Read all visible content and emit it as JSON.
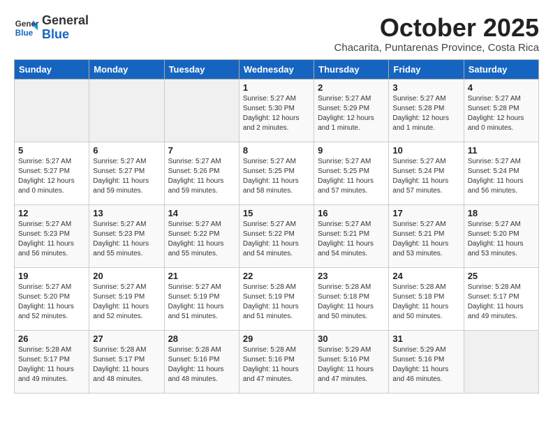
{
  "header": {
    "logo_general": "General",
    "logo_blue": "Blue",
    "month_title": "October 2025",
    "subtitle": "Chacarita, Puntarenas Province, Costa Rica"
  },
  "days_of_week": [
    "Sunday",
    "Monday",
    "Tuesday",
    "Wednesday",
    "Thursday",
    "Friday",
    "Saturday"
  ],
  "weeks": [
    [
      {
        "day": "",
        "details": ""
      },
      {
        "day": "",
        "details": ""
      },
      {
        "day": "",
        "details": ""
      },
      {
        "day": "1",
        "details": "Sunrise: 5:27 AM\nSunset: 5:30 PM\nDaylight: 12 hours\nand 2 minutes."
      },
      {
        "day": "2",
        "details": "Sunrise: 5:27 AM\nSunset: 5:29 PM\nDaylight: 12 hours\nand 1 minute."
      },
      {
        "day": "3",
        "details": "Sunrise: 5:27 AM\nSunset: 5:28 PM\nDaylight: 12 hours\nand 1 minute."
      },
      {
        "day": "4",
        "details": "Sunrise: 5:27 AM\nSunset: 5:28 PM\nDaylight: 12 hours\nand 0 minutes."
      }
    ],
    [
      {
        "day": "5",
        "details": "Sunrise: 5:27 AM\nSunset: 5:27 PM\nDaylight: 12 hours\nand 0 minutes."
      },
      {
        "day": "6",
        "details": "Sunrise: 5:27 AM\nSunset: 5:27 PM\nDaylight: 11 hours\nand 59 minutes."
      },
      {
        "day": "7",
        "details": "Sunrise: 5:27 AM\nSunset: 5:26 PM\nDaylight: 11 hours\nand 59 minutes."
      },
      {
        "day": "8",
        "details": "Sunrise: 5:27 AM\nSunset: 5:25 PM\nDaylight: 11 hours\nand 58 minutes."
      },
      {
        "day": "9",
        "details": "Sunrise: 5:27 AM\nSunset: 5:25 PM\nDaylight: 11 hours\nand 57 minutes."
      },
      {
        "day": "10",
        "details": "Sunrise: 5:27 AM\nSunset: 5:24 PM\nDaylight: 11 hours\nand 57 minutes."
      },
      {
        "day": "11",
        "details": "Sunrise: 5:27 AM\nSunset: 5:24 PM\nDaylight: 11 hours\nand 56 minutes."
      }
    ],
    [
      {
        "day": "12",
        "details": "Sunrise: 5:27 AM\nSunset: 5:23 PM\nDaylight: 11 hours\nand 56 minutes."
      },
      {
        "day": "13",
        "details": "Sunrise: 5:27 AM\nSunset: 5:23 PM\nDaylight: 11 hours\nand 55 minutes."
      },
      {
        "day": "14",
        "details": "Sunrise: 5:27 AM\nSunset: 5:22 PM\nDaylight: 11 hours\nand 55 minutes."
      },
      {
        "day": "15",
        "details": "Sunrise: 5:27 AM\nSunset: 5:22 PM\nDaylight: 11 hours\nand 54 minutes."
      },
      {
        "day": "16",
        "details": "Sunrise: 5:27 AM\nSunset: 5:21 PM\nDaylight: 11 hours\nand 54 minutes."
      },
      {
        "day": "17",
        "details": "Sunrise: 5:27 AM\nSunset: 5:21 PM\nDaylight: 11 hours\nand 53 minutes."
      },
      {
        "day": "18",
        "details": "Sunrise: 5:27 AM\nSunset: 5:20 PM\nDaylight: 11 hours\nand 53 minutes."
      }
    ],
    [
      {
        "day": "19",
        "details": "Sunrise: 5:27 AM\nSunset: 5:20 PM\nDaylight: 11 hours\nand 52 minutes."
      },
      {
        "day": "20",
        "details": "Sunrise: 5:27 AM\nSunset: 5:19 PM\nDaylight: 11 hours\nand 52 minutes."
      },
      {
        "day": "21",
        "details": "Sunrise: 5:27 AM\nSunset: 5:19 PM\nDaylight: 11 hours\nand 51 minutes."
      },
      {
        "day": "22",
        "details": "Sunrise: 5:28 AM\nSunset: 5:19 PM\nDaylight: 11 hours\nand 51 minutes."
      },
      {
        "day": "23",
        "details": "Sunrise: 5:28 AM\nSunset: 5:18 PM\nDaylight: 11 hours\nand 50 minutes."
      },
      {
        "day": "24",
        "details": "Sunrise: 5:28 AM\nSunset: 5:18 PM\nDaylight: 11 hours\nand 50 minutes."
      },
      {
        "day": "25",
        "details": "Sunrise: 5:28 AM\nSunset: 5:17 PM\nDaylight: 11 hours\nand 49 minutes."
      }
    ],
    [
      {
        "day": "26",
        "details": "Sunrise: 5:28 AM\nSunset: 5:17 PM\nDaylight: 11 hours\nand 49 minutes."
      },
      {
        "day": "27",
        "details": "Sunrise: 5:28 AM\nSunset: 5:17 PM\nDaylight: 11 hours\nand 48 minutes."
      },
      {
        "day": "28",
        "details": "Sunrise: 5:28 AM\nSunset: 5:16 PM\nDaylight: 11 hours\nand 48 minutes."
      },
      {
        "day": "29",
        "details": "Sunrise: 5:28 AM\nSunset: 5:16 PM\nDaylight: 11 hours\nand 47 minutes."
      },
      {
        "day": "30",
        "details": "Sunrise: 5:29 AM\nSunset: 5:16 PM\nDaylight: 11 hours\nand 47 minutes."
      },
      {
        "day": "31",
        "details": "Sunrise: 5:29 AM\nSunset: 5:16 PM\nDaylight: 11 hours\nand 46 minutes."
      },
      {
        "day": "",
        "details": ""
      }
    ]
  ]
}
